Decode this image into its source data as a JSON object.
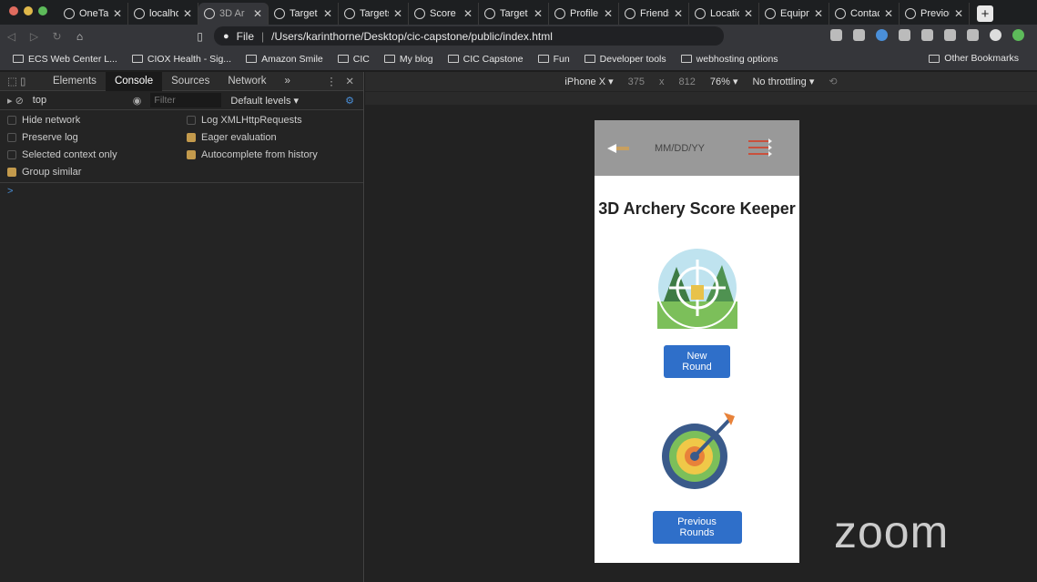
{
  "tabs": [
    {
      "label": "OneTab",
      "active": false
    },
    {
      "label": "localho",
      "active": false
    },
    {
      "label": "3D Ar",
      "active": true
    },
    {
      "label": "Target",
      "active": false
    },
    {
      "label": "Targets",
      "active": false
    },
    {
      "label": "Score",
      "active": false
    },
    {
      "label": "Target",
      "active": false
    },
    {
      "label": "Profile",
      "active": false
    },
    {
      "label": "Friends",
      "active": false
    },
    {
      "label": "Locatio",
      "active": false
    },
    {
      "label": "Equipm",
      "active": false
    },
    {
      "label": "Contac",
      "active": false
    },
    {
      "label": "Previou",
      "active": false
    }
  ],
  "address": {
    "scheme": "File",
    "url": "/Users/karinthorne/Desktop/cic-capstone/public/index.html"
  },
  "bookmarks": [
    "ECS Web Center L...",
    "CIOX Health - Sig...",
    "Amazon Smile",
    "CIC",
    "My blog",
    "CIC Capstone",
    "Fun",
    "Developer tools",
    "webhosting options"
  ],
  "other_bookmarks": "Other Bookmarks",
  "devtools": {
    "tabs": [
      "Elements",
      "Console",
      "Sources",
      "Network"
    ],
    "more": "»",
    "context": "top",
    "filter_placeholder": "Filter",
    "levels": "Default levels ▾",
    "settings": [
      {
        "label": "Hide network",
        "checked": false
      },
      {
        "label": "Log XMLHttpRequests",
        "checked": false
      },
      {
        "label": "Preserve log",
        "checked": false
      },
      {
        "label": "Eager evaluation",
        "checked": true
      },
      {
        "label": "Selected context only",
        "checked": false
      },
      {
        "label": "Autocomplete from history",
        "checked": true
      },
      {
        "label": "Group similar",
        "checked": true
      }
    ],
    "prompt": ">"
  },
  "device": {
    "name": "iPhone X ▾",
    "width": "375",
    "x": "x",
    "height": "812",
    "zoom": "76% ▾",
    "throttle": "No throttling ▾"
  },
  "app": {
    "date_placeholder": "MM/DD/YY",
    "title": "3D Archery Score Keeper",
    "new_round": "New Round",
    "previous_rounds": "Previous Rounds"
  },
  "overlay": "zoom"
}
